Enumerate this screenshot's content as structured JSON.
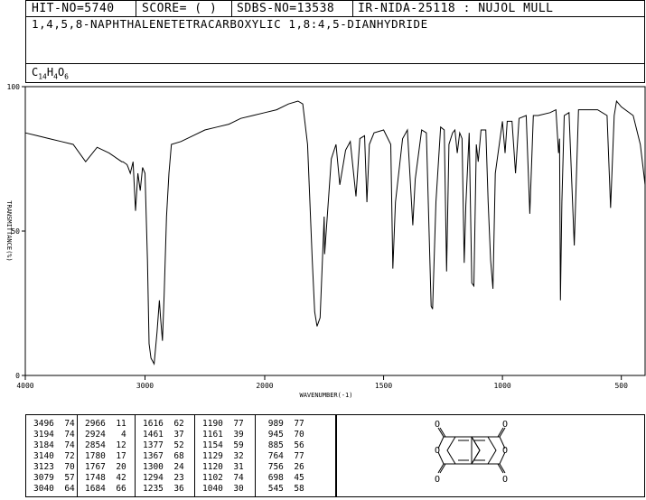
{
  "header": {
    "hit_no": "HIT-NO=5740",
    "score": "SCORE=  (   )",
    "sdbs_no": "SDBS-NO=13538",
    "ir": "IR-NIDA-25118 : NUJOL MULL",
    "compound_name": "1,4,5,8-NAPHTHALENETETRACARBOXYLIC 1,8:4,5-DIANHYDRIDE",
    "formula": {
      "c": "C",
      "c_n": "14",
      "h": "H",
      "h_n": "4",
      "o": "O",
      "o_n": "6"
    }
  },
  "chart_data": {
    "type": "line",
    "xlabel": "WAVENUMBER(-1)",
    "ylabel": "TRANSMITTANCE(%)",
    "xlim": [
      4000,
      400
    ],
    "ylim": [
      0,
      100
    ],
    "x_ticks": [
      4000,
      3000,
      2000,
      1500,
      1000,
      500
    ],
    "y_ticks": [
      0,
      50,
      100
    ],
    "series": [
      {
        "points": [
          [
            4000,
            84
          ],
          [
            3900,
            83
          ],
          [
            3800,
            82
          ],
          [
            3700,
            81
          ],
          [
            3600,
            80
          ],
          [
            3496,
            74
          ],
          [
            3400,
            79
          ],
          [
            3300,
            77
          ],
          [
            3194,
            74
          ],
          [
            3184,
            74
          ],
          [
            3150,
            73
          ],
          [
            3140,
            72
          ],
          [
            3123,
            70
          ],
          [
            3100,
            74
          ],
          [
            3079,
            57
          ],
          [
            3060,
            70
          ],
          [
            3040,
            64
          ],
          [
            3020,
            72
          ],
          [
            3000,
            70
          ],
          [
            2980,
            40
          ],
          [
            2966,
            11
          ],
          [
            2950,
            6
          ],
          [
            2924,
            4
          ],
          [
            2900,
            15
          ],
          [
            2880,
            26
          ],
          [
            2870,
            20
          ],
          [
            2854,
            12
          ],
          [
            2840,
            28
          ],
          [
            2820,
            55
          ],
          [
            2800,
            70
          ],
          [
            2780,
            80
          ],
          [
            2700,
            81
          ],
          [
            2600,
            83
          ],
          [
            2500,
            85
          ],
          [
            2400,
            86
          ],
          [
            2300,
            87
          ],
          [
            2200,
            89
          ],
          [
            2100,
            90
          ],
          [
            2000,
            91
          ],
          [
            1950,
            92
          ],
          [
            1900,
            94
          ],
          [
            1860,
            95
          ],
          [
            1840,
            94
          ],
          [
            1820,
            80
          ],
          [
            1800,
            40
          ],
          [
            1790,
            22
          ],
          [
            1780,
            17
          ],
          [
            1767,
            20
          ],
          [
            1750,
            55
          ],
          [
            1748,
            42
          ],
          [
            1720,
            75
          ],
          [
            1700,
            80
          ],
          [
            1684,
            66
          ],
          [
            1660,
            78
          ],
          [
            1640,
            81
          ],
          [
            1616,
            62
          ],
          [
            1600,
            82
          ],
          [
            1580,
            83
          ],
          [
            1570,
            60
          ],
          [
            1560,
            80
          ],
          [
            1540,
            84
          ],
          [
            1500,
            85
          ],
          [
            1470,
            80
          ],
          [
            1461,
            37
          ],
          [
            1450,
            60
          ],
          [
            1420,
            82
          ],
          [
            1400,
            85
          ],
          [
            1377,
            52
          ],
          [
            1367,
            68
          ],
          [
            1340,
            85
          ],
          [
            1320,
            84
          ],
          [
            1300,
            24
          ],
          [
            1294,
            23
          ],
          [
            1280,
            60
          ],
          [
            1260,
            86
          ],
          [
            1245,
            85
          ],
          [
            1235,
            36
          ],
          [
            1225,
            80
          ],
          [
            1210,
            84
          ],
          [
            1200,
            85
          ],
          [
            1190,
            77
          ],
          [
            1180,
            84
          ],
          [
            1170,
            82
          ],
          [
            1161,
            39
          ],
          [
            1154,
            59
          ],
          [
            1140,
            84
          ],
          [
            1129,
            32
          ],
          [
            1120,
            31
          ],
          [
            1110,
            80
          ],
          [
            1102,
            74
          ],
          [
            1090,
            85
          ],
          [
            1070,
            85
          ],
          [
            1060,
            60
          ],
          [
            1050,
            40
          ],
          [
            1040,
            30
          ],
          [
            1030,
            70
          ],
          [
            1000,
            88
          ],
          [
            989,
            77
          ],
          [
            980,
            88
          ],
          [
            960,
            88
          ],
          [
            945,
            70
          ],
          [
            930,
            89
          ],
          [
            900,
            90
          ],
          [
            885,
            56
          ],
          [
            870,
            90
          ],
          [
            850,
            90
          ],
          [
            800,
            91
          ],
          [
            775,
            92
          ],
          [
            764,
            77
          ],
          [
            760,
            82
          ],
          [
            756,
            26
          ],
          [
            750,
            60
          ],
          [
            740,
            90
          ],
          [
            720,
            91
          ],
          [
            698,
            45
          ],
          [
            680,
            92
          ],
          [
            650,
            92
          ],
          [
            600,
            92
          ],
          [
            560,
            90
          ],
          [
            545,
            58
          ],
          [
            530,
            90
          ],
          [
            520,
            95
          ],
          [
            500,
            93
          ],
          [
            450,
            90
          ],
          [
            420,
            80
          ],
          [
            400,
            66
          ]
        ]
      }
    ],
    "peaks": [
      [
        [
          "3496",
          "74"
        ],
        [
          "3194",
          "74"
        ],
        [
          "3184",
          "74"
        ],
        [
          "3140",
          "72"
        ],
        [
          "3123",
          "70"
        ],
        [
          "3079",
          "57"
        ],
        [
          "3040",
          "64"
        ]
      ],
      [
        [
          "2966",
          "11"
        ],
        [
          "2924",
          "4"
        ],
        [
          "2854",
          "12"
        ],
        [
          "1780",
          "17"
        ],
        [
          "1767",
          "20"
        ],
        [
          "1748",
          "42"
        ],
        [
          "1684",
          "66"
        ]
      ],
      [
        [
          "1616",
          "62"
        ],
        [
          "1461",
          "37"
        ],
        [
          "1377",
          "52"
        ],
        [
          "1367",
          "68"
        ],
        [
          "1300",
          "24"
        ],
        [
          "1294",
          "23"
        ],
        [
          "1235",
          "36"
        ]
      ],
      [
        [
          "1190",
          "77"
        ],
        [
          "1161",
          "39"
        ],
        [
          "1154",
          "59"
        ],
        [
          "1129",
          "32"
        ],
        [
          "1120",
          "31"
        ],
        [
          "1102",
          "74"
        ],
        [
          "1040",
          "30"
        ]
      ],
      [
        [
          "989",
          "77"
        ],
        [
          "945",
          "70"
        ],
        [
          "885",
          "56"
        ],
        [
          "764",
          "77"
        ],
        [
          "756",
          "26"
        ],
        [
          "698",
          "45"
        ],
        [
          "545",
          "58"
        ]
      ]
    ]
  },
  "structure": {
    "atom_o": "O",
    "atom_o_ring": "O"
  }
}
